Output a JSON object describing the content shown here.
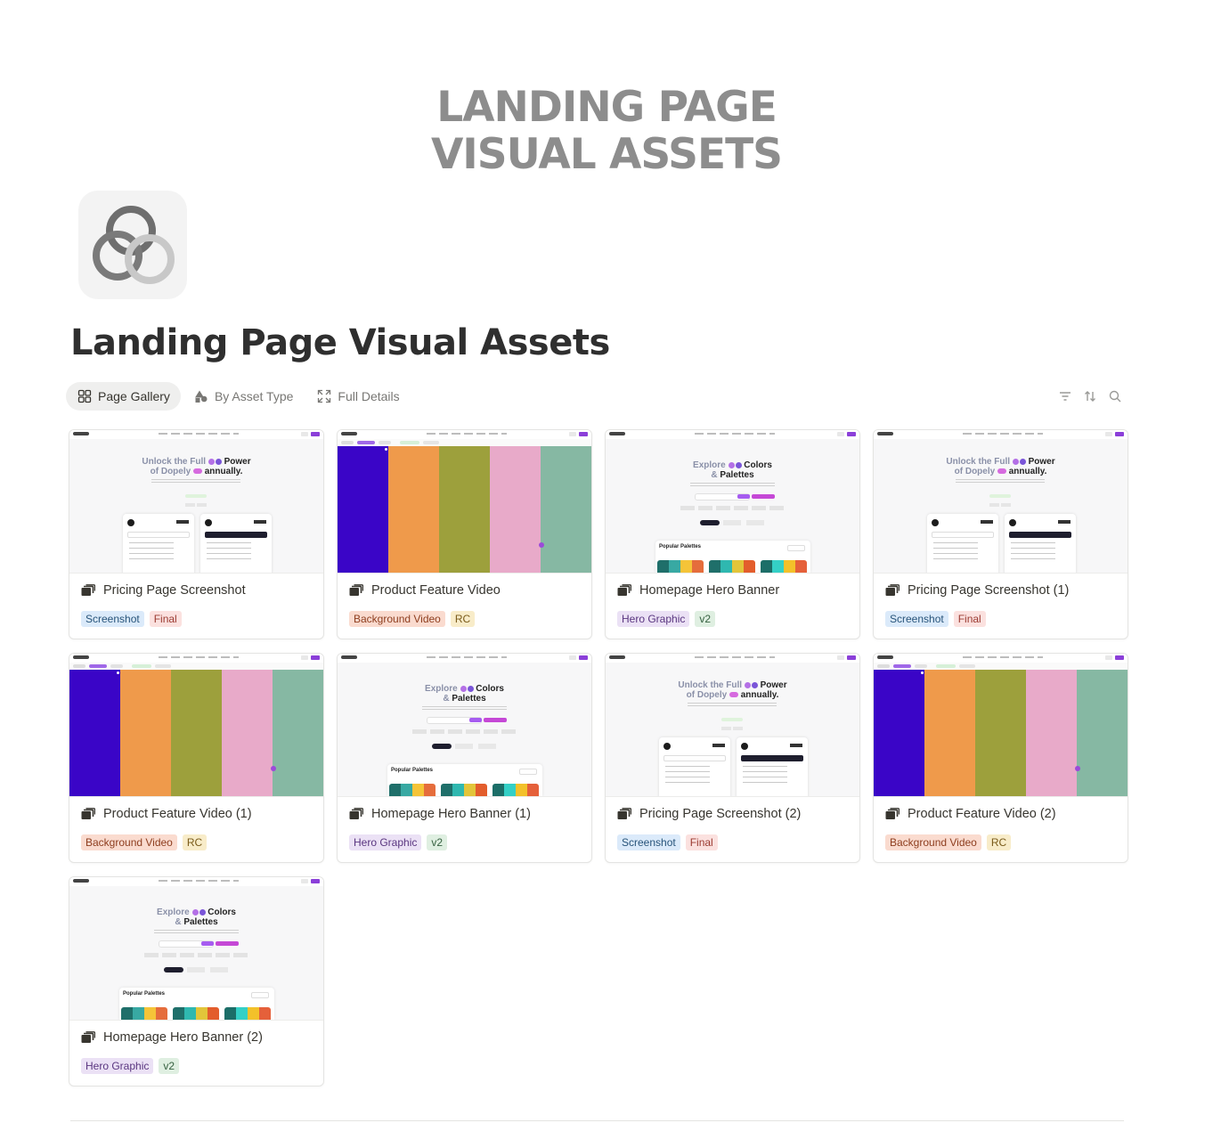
{
  "cover": {
    "line1": "LANDING PAGE",
    "line2": "VISUAL ASSETS"
  },
  "page": {
    "title": "Landing Page Visual Assets",
    "icon": "overlapping-circles-icon"
  },
  "views": [
    {
      "label": "Page Gallery",
      "icon": "gallery-grid-icon",
      "active": true
    },
    {
      "label": "By Asset Type",
      "icon": "shapes-icon",
      "active": false
    },
    {
      "label": "Full Details",
      "icon": "expand-icon",
      "active": false
    }
  ],
  "toolbar": [
    "filter-icon",
    "sort-icon",
    "search-icon"
  ],
  "colors": {
    "stripes": [
      "#3a05c7",
      "#ef9a4b",
      "#9da03c",
      "#e8aac9",
      "#86b8a3"
    ],
    "accent": "#8b3fd9"
  },
  "cards": [
    {
      "title": "Pricing Page Screenshot",
      "thumb": "pricing",
      "tags": [
        {
          "label": "Screenshot",
          "color": "blue"
        },
        {
          "label": "Final",
          "color": "red"
        }
      ]
    },
    {
      "title": "Product Feature Video",
      "thumb": "video",
      "tags": [
        {
          "label": "Background Video",
          "color": "orange"
        },
        {
          "label": "RC",
          "color": "yellow"
        }
      ]
    },
    {
      "title": "Homepage Hero Banner",
      "thumb": "explore",
      "tags": [
        {
          "label": "Hero Graphic",
          "color": "purple"
        },
        {
          "label": "v2",
          "color": "green"
        }
      ]
    },
    {
      "title": "Pricing Page Screenshot (1)",
      "thumb": "pricing",
      "tags": [
        {
          "label": "Screenshot",
          "color": "blue"
        },
        {
          "label": "Final",
          "color": "red"
        }
      ]
    },
    {
      "title": "Product Feature Video (1)",
      "thumb": "video",
      "tags": [
        {
          "label": "Background Video",
          "color": "orange"
        },
        {
          "label": "RC",
          "color": "yellow"
        }
      ]
    },
    {
      "title": "Homepage Hero Banner (1)",
      "thumb": "explore",
      "tags": [
        {
          "label": "Hero Graphic",
          "color": "purple"
        },
        {
          "label": "v2",
          "color": "green"
        }
      ]
    },
    {
      "title": "Pricing Page Screenshot (2)",
      "thumb": "pricing",
      "tags": [
        {
          "label": "Screenshot",
          "color": "blue"
        },
        {
          "label": "Final",
          "color": "red"
        }
      ]
    },
    {
      "title": "Product Feature Video (2)",
      "thumb": "video",
      "tags": [
        {
          "label": "Background Video",
          "color": "orange"
        },
        {
          "label": "RC",
          "color": "yellow"
        }
      ]
    },
    {
      "title": "Homepage Hero Banner (2)",
      "thumb": "explore",
      "tags": [
        {
          "label": "Hero Graphic",
          "color": "purple"
        },
        {
          "label": "v2",
          "color": "green"
        }
      ]
    }
  ],
  "thumb_text": {
    "pricing": {
      "l1a": "Unlock the Full",
      "l1b": "Power",
      "l2a": "of Dopely",
      "l2b": "annually."
    },
    "explore": {
      "l1a": "Explore",
      "l1b": "Colors",
      "l2a": "&",
      "l2b": "Palettes",
      "popular": "Popular Palettes"
    }
  }
}
